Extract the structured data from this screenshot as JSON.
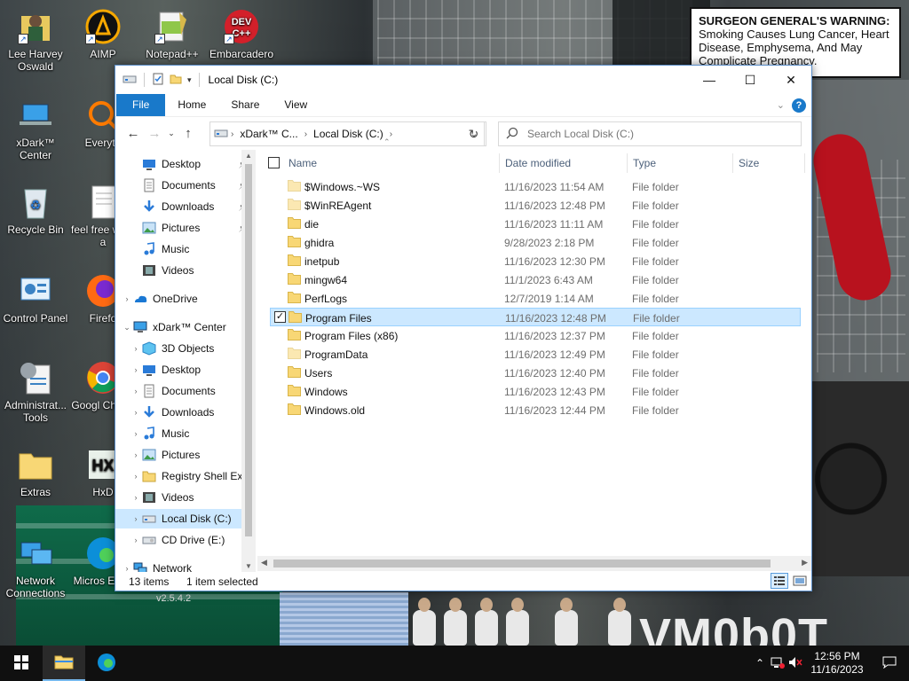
{
  "desktop": {
    "icons": [
      {
        "label": "Lee Harvey Oswald",
        "icon": "person-folder-icon"
      },
      {
        "label": "AIMP",
        "icon": "aimp-icon"
      },
      {
        "label": "Notepad++",
        "icon": "notepadpp-icon"
      },
      {
        "label": "Embarcadero",
        "icon": "devcpp-icon"
      },
      {
        "label": "xDark™ Center",
        "icon": "laptop-icon"
      },
      {
        "label": "Everyth",
        "icon": "search-app-icon"
      },
      {
        "label": "Recycle Bin",
        "icon": "recycle-bin-icon"
      },
      {
        "label": "feel free write a",
        "icon": "text-file-icon"
      },
      {
        "label": "Control Panel",
        "icon": "control-panel-icon"
      },
      {
        "label": "Firefo",
        "icon": "firefox-icon"
      },
      {
        "label": "Administrat... Tools",
        "icon": "admin-tools-icon"
      },
      {
        "label": "Googl Chrom",
        "icon": "chrome-icon"
      },
      {
        "label": "Extras",
        "icon": "folder-icon"
      },
      {
        "label": "HxD",
        "icon": "hxd-icon"
      },
      {
        "label": "Network Connections",
        "icon": "network-icon"
      },
      {
        "label": "Micros Edge",
        "icon": "edge-icon"
      }
    ],
    "warning_title": "SURGEON GENERAL'S WARNING:",
    "warning_text": " Smoking Causes Lung Cancer, Heart Disease, Emphysema, And May Complicate Pregnancy.",
    "watermark": "VM0b0T",
    "version_text": "v2.5.4.2"
  },
  "window": {
    "title": "Local Disk (C:)",
    "caption": {
      "minimize": "—",
      "maximize": "☐",
      "close": "✕"
    },
    "ribbon_tabs": [
      "File",
      "Home",
      "Share",
      "View"
    ],
    "address": {
      "crumbs": [
        "xDark™ C...",
        "Local Disk (C:)"
      ],
      "refresh": "↻"
    },
    "search": {
      "placeholder": "Search Local Disk (C:)"
    },
    "nav": {
      "items": [
        {
          "label": "Desktop",
          "icon": "desktop-icon",
          "pinned": true
        },
        {
          "label": "Documents",
          "icon": "documents-icon",
          "pinned": true
        },
        {
          "label": "Downloads",
          "icon": "downloads-icon",
          "pinned": true
        },
        {
          "label": "Pictures",
          "icon": "pictures-icon",
          "pinned": true
        },
        {
          "label": "Music",
          "icon": "music-icon",
          "pinned": false
        },
        {
          "label": "Videos",
          "icon": "videos-icon",
          "pinned": false
        },
        {
          "label": "OneDrive",
          "icon": "onedrive-icon",
          "pinned": false
        },
        {
          "label": "xDark™ Center",
          "icon": "this-pc-icon",
          "pinned": false
        },
        {
          "label": "3D Objects",
          "icon": "3d-objects-icon",
          "pinned": false
        },
        {
          "label": "Desktop",
          "icon": "desktop-icon",
          "pinned": false
        },
        {
          "label": "Documents",
          "icon": "documents-icon",
          "pinned": false
        },
        {
          "label": "Downloads",
          "icon": "downloads-icon",
          "pinned": false
        },
        {
          "label": "Music",
          "icon": "music-icon",
          "pinned": false
        },
        {
          "label": "Pictures",
          "icon": "pictures-icon",
          "pinned": false
        },
        {
          "label": "Registry Shell Ex",
          "icon": "folder-icon",
          "pinned": false
        },
        {
          "label": "Videos",
          "icon": "videos-icon",
          "pinned": false
        },
        {
          "label": "Local Disk (C:)",
          "icon": "drive-icon",
          "pinned": false
        },
        {
          "label": "CD Drive (E:)",
          "icon": "cd-drive-icon",
          "pinned": false
        },
        {
          "label": "Network",
          "icon": "network-icon",
          "pinned": false
        }
      ]
    },
    "columns": {
      "name": "Name",
      "date": "Date modified",
      "type": "Type",
      "size": "Size"
    },
    "files": [
      {
        "name": "$Windows.~WS",
        "date": "11/16/2023 11:54 AM",
        "type": "File folder",
        "selected": false,
        "faded": true
      },
      {
        "name": "$WinREAgent",
        "date": "11/16/2023 12:48 PM",
        "type": "File folder",
        "selected": false,
        "faded": true
      },
      {
        "name": "die",
        "date": "11/16/2023 11:11 AM",
        "type": "File folder",
        "selected": false,
        "faded": false
      },
      {
        "name": "ghidra",
        "date": "9/28/2023 2:18 PM",
        "type": "File folder",
        "selected": false,
        "faded": false
      },
      {
        "name": "inetpub",
        "date": "11/16/2023 12:30 PM",
        "type": "File folder",
        "selected": false,
        "faded": false
      },
      {
        "name": "mingw64",
        "date": "11/1/2023 6:43 AM",
        "type": "File folder",
        "selected": false,
        "faded": false
      },
      {
        "name": "PerfLogs",
        "date": "12/7/2019 1:14 AM",
        "type": "File folder",
        "selected": false,
        "faded": false
      },
      {
        "name": "Program Files",
        "date": "11/16/2023 12:48 PM",
        "type": "File folder",
        "selected": true,
        "faded": false
      },
      {
        "name": "Program Files (x86)",
        "date": "11/16/2023 12:37 PM",
        "type": "File folder",
        "selected": false,
        "faded": false
      },
      {
        "name": "ProgramData",
        "date": "11/16/2023 12:49 PM",
        "type": "File folder",
        "selected": false,
        "faded": true
      },
      {
        "name": "Users",
        "date": "11/16/2023 12:40 PM",
        "type": "File folder",
        "selected": false,
        "faded": false
      },
      {
        "name": "Windows",
        "date": "11/16/2023 12:43 PM",
        "type": "File folder",
        "selected": false,
        "faded": false
      },
      {
        "name": "Windows.old",
        "date": "11/16/2023 12:44 PM",
        "type": "File folder",
        "selected": false,
        "faded": false
      }
    ],
    "status": {
      "count": "13 items",
      "selection": "1 item selected"
    }
  },
  "taskbar": {
    "time": "12:56 PM",
    "date": "11/16/2023",
    "apps": [
      {
        "icon": "start-icon"
      },
      {
        "icon": "file-explorer-icon",
        "active": true
      },
      {
        "icon": "edge-icon",
        "active": false
      }
    ]
  },
  "colors": {
    "accent": "#1979ca",
    "selection": "#cce8ff",
    "folder": "#f8d775"
  }
}
